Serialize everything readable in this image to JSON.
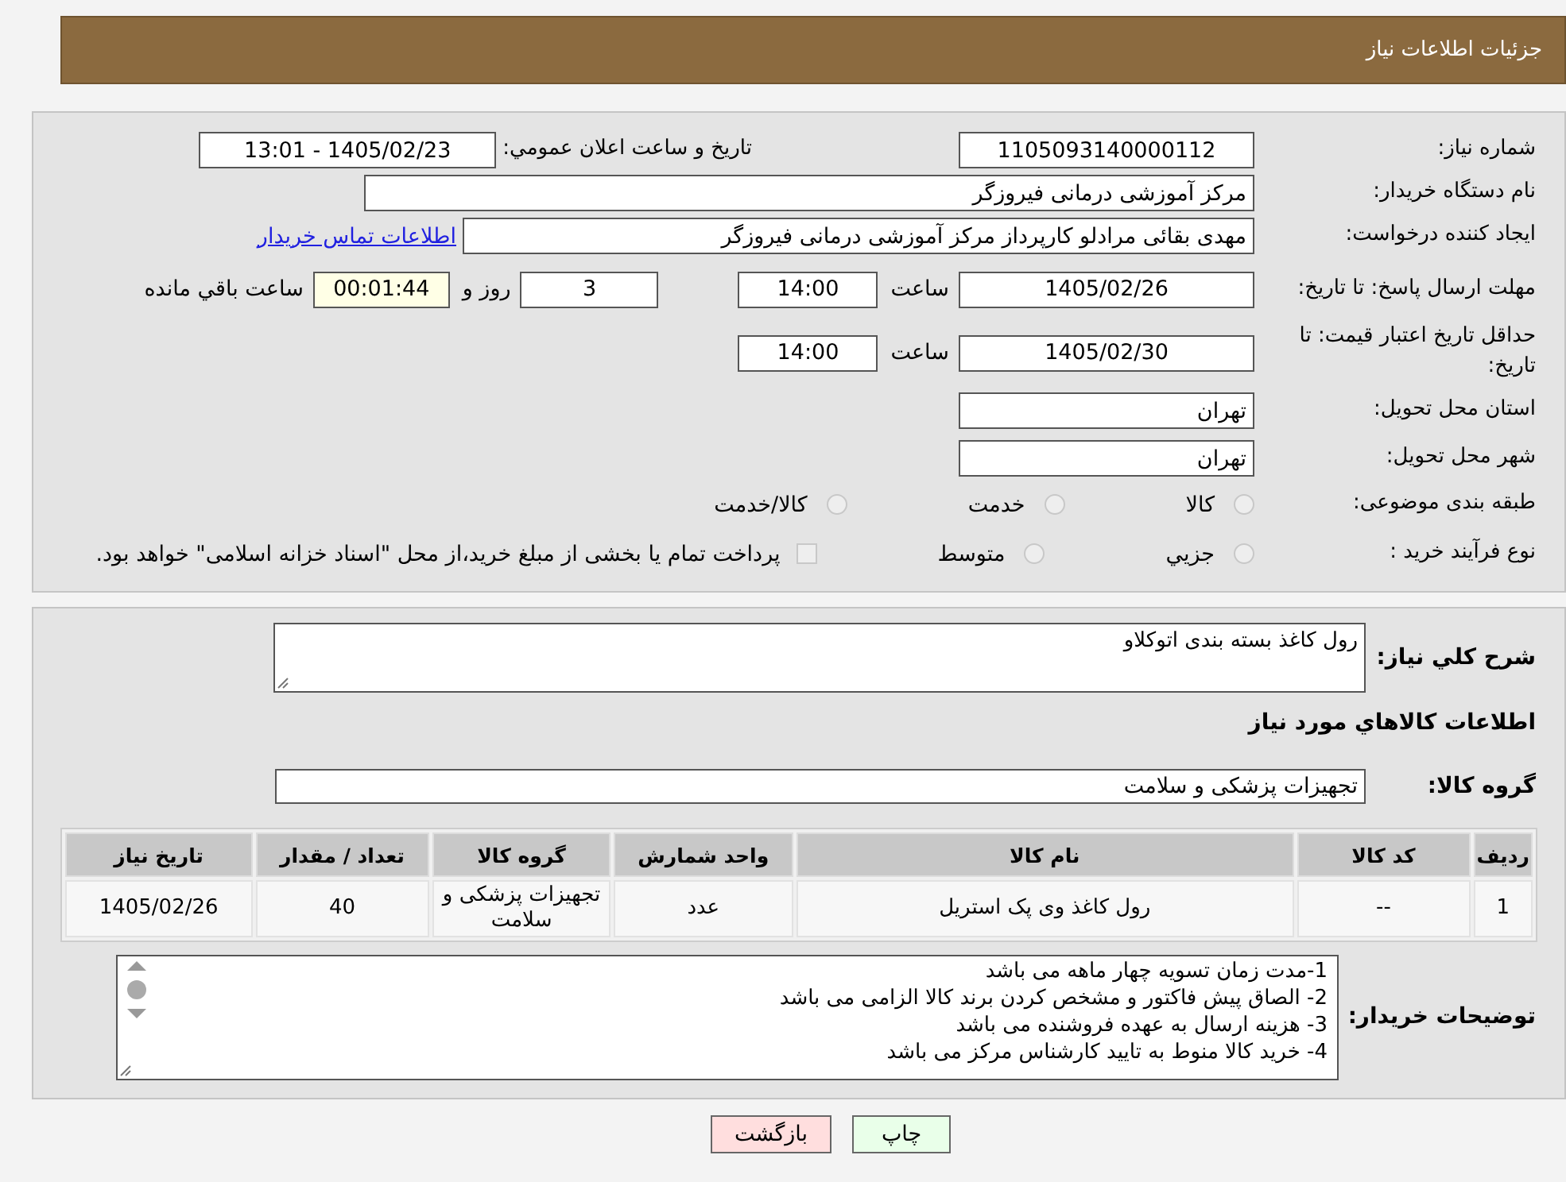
{
  "header": {
    "title": "جزئیات اطلاعات نیاز"
  },
  "need_number": {
    "label": "شماره نیاز:",
    "value": "1105093140000112"
  },
  "announce": {
    "label": "تاریخ و ساعت اعلان عمومي:",
    "value": "1405/02/23 - 13:01"
  },
  "buyer": {
    "label": "نام دستگاه خریدار:",
    "value": "مرکز آموزشی درمانی فیروزگر"
  },
  "creator": {
    "label": "ایجاد کننده درخواست:",
    "value": "مهدی بقائی مرادلو کارپرداز مرکز آموزشی درمانی فیروزگر",
    "link": "اطلاعات تماس خریدار"
  },
  "deadline": {
    "label": "مهلت ارسال پاسخ: تا تاریخ:",
    "date": "1405/02/26",
    "time_label": "ساعت",
    "time": "14:00",
    "days": "3",
    "days_label": "روز و",
    "remaining": "00:01:44",
    "remaining_label": "ساعت باقي مانده"
  },
  "validity": {
    "label": "حداقل تاریخ اعتبار قیمت: تا تاریخ:",
    "date": "1405/02/30",
    "time_label": "ساعت",
    "time": "14:00"
  },
  "province": {
    "label": "استان محل تحویل:",
    "value": "تهران"
  },
  "city": {
    "label": "شهر محل تحویل:",
    "value": "تهران"
  },
  "category": {
    "label": "طبقه بندی موضوعی:",
    "options": [
      {
        "label": "کالا",
        "selected": false
      },
      {
        "label": "خدمت",
        "selected": false
      },
      {
        "label": "کالا/خدمت",
        "selected": false
      }
    ]
  },
  "process": {
    "label": "نوع فرآیند خرید :",
    "options": [
      {
        "label": "جزيي",
        "selected": false
      },
      {
        "label": "متوسط",
        "selected": false
      }
    ],
    "treasury": {
      "checked": false,
      "text": "پرداخت تمام يا بخشی از مبلغ خرید،از محل \"اسناد خزانه اسلامی\" خواهد بود."
    }
  },
  "description": {
    "label": "شرح کلي نياز:",
    "value": "رول کاغذ بسته بندی اتوکلاو"
  },
  "goods_heading": "اطلاعات کالاهاي مورد نياز",
  "goods_group": {
    "label": "گروه کالا:",
    "value": "تجهیزات پزشکی و سلامت"
  },
  "table": {
    "columns": [
      "ردیف",
      "کد کالا",
      "نام کالا",
      "واحد شمارش",
      "گروه کالا",
      "تعداد / مقدار",
      "تاریخ نیاز"
    ],
    "rows": [
      [
        "1",
        "--",
        "رول کاغذ وی پک استریل",
        "عدد",
        "تجهیزات پزشکی و سلامت",
        "40",
        "1405/02/26"
      ]
    ]
  },
  "notes": {
    "label": "توضیحات خریدار:",
    "lines": [
      "1-مدت زمان تسویه  چهار ماهه می باشد",
      "2- الصاق پیش فاکتور و مشخص کردن برند کالا  الزامی می باشد",
      "3- هزینه ارسال به عهده فروشنده می باشد",
      "4-  خرید کالا منوط  به تایید کارشناس مرکز می باشد"
    ]
  },
  "buttons": [
    {
      "label": "چاپ",
      "kind": "print"
    },
    {
      "label": "بازگشت",
      "kind": "back"
    }
  ]
}
